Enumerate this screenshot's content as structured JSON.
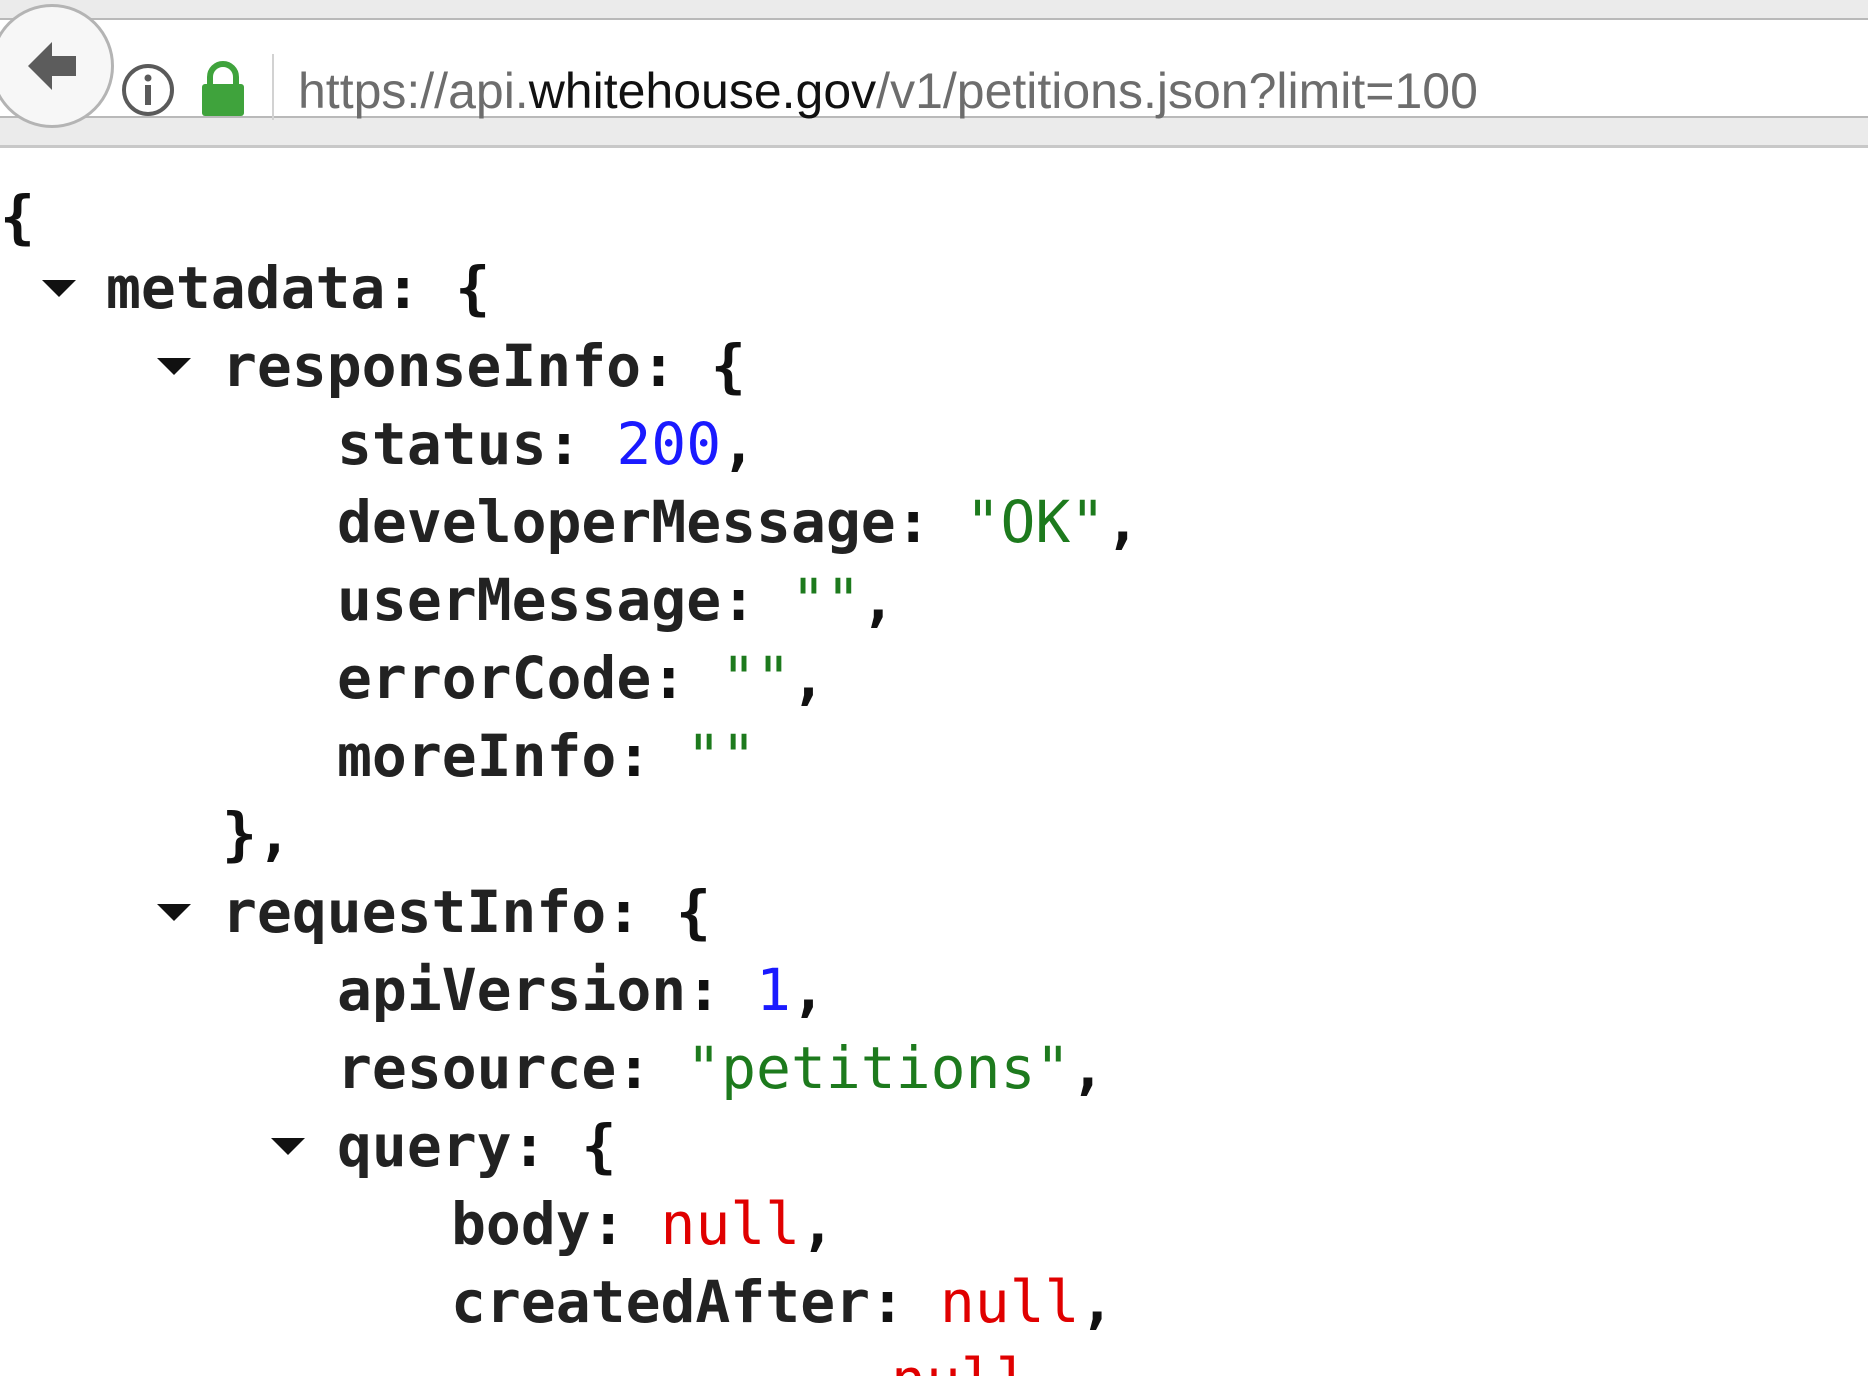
{
  "browser": {
    "url_prefix": "https://api.",
    "url_host": "whitehouse.gov",
    "url_path": "/v1/petitions.json?limit=100",
    "icons": [
      "back-arrow-icon",
      "info-icon",
      "lock-icon"
    ],
    "colors": {
      "lock": "#3fa33c"
    }
  },
  "json": {
    "open_brace": "{",
    "metadata_key": "metadata",
    "responseInfo_key": "responseInfo",
    "status_key": "status",
    "status_value": "200",
    "developerMessage_key": "developerMessage",
    "developerMessage_value": "\"OK\"",
    "userMessage_key": "userMessage",
    "userMessage_value": "\"\"",
    "errorCode_key": "errorCode",
    "errorCode_value": "\"\"",
    "moreInfo_key": "moreInfo",
    "moreInfo_value": "\"\"",
    "close_responseInfo": "},",
    "requestInfo_key": "requestInfo",
    "apiVersion_key": "apiVersion",
    "apiVersion_value": "1",
    "resource_key": "resource",
    "resource_value": "\"petitions\"",
    "query_key": "query",
    "body_key": "body",
    "body_value": "null",
    "createdAfter_key": "createdAfter",
    "createdAfter_value": "null",
    "next_value": "null"
  },
  "colors": {
    "number": "#1a1aff",
    "string": "#1d7a1d",
    "null": "#e00000"
  }
}
